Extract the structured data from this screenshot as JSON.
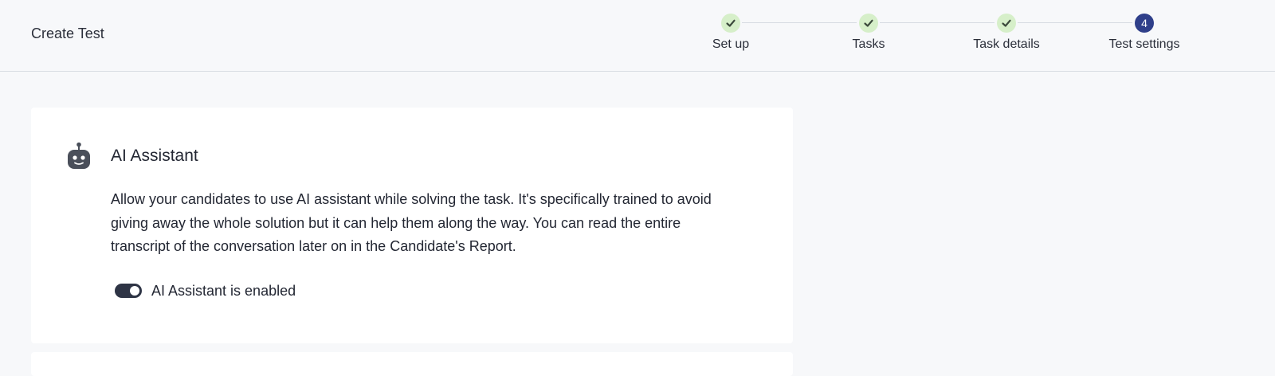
{
  "header": {
    "title": "Create Test"
  },
  "stepper": {
    "steps": [
      {
        "label": "Set up",
        "status": "done",
        "icon": "check-icon"
      },
      {
        "label": "Tasks",
        "status": "done",
        "icon": "check-icon"
      },
      {
        "label": "Task details",
        "status": "done",
        "icon": "check-icon"
      },
      {
        "label": "Test settings",
        "status": "active",
        "number": "4"
      }
    ]
  },
  "ai_assistant": {
    "icon": "robot-icon",
    "title": "AI Assistant",
    "description": "Allow your candidates to use AI assistant while solving the task. It's specifically trained to avoid giving away the whole solution but it can help them along the way. You can read the entire transcript of the conversation later on in the Candidate's Report.",
    "toggle": {
      "enabled": true,
      "label": "AI Assistant is enabled"
    }
  },
  "colors": {
    "background": "#f7f8fa",
    "card": "#ffffff",
    "step_done": "#d6efc9",
    "step_check": "#3c4a3c",
    "step_active": "#2f3f8a",
    "toggle_on": "#2e3445",
    "text": "#232733"
  }
}
